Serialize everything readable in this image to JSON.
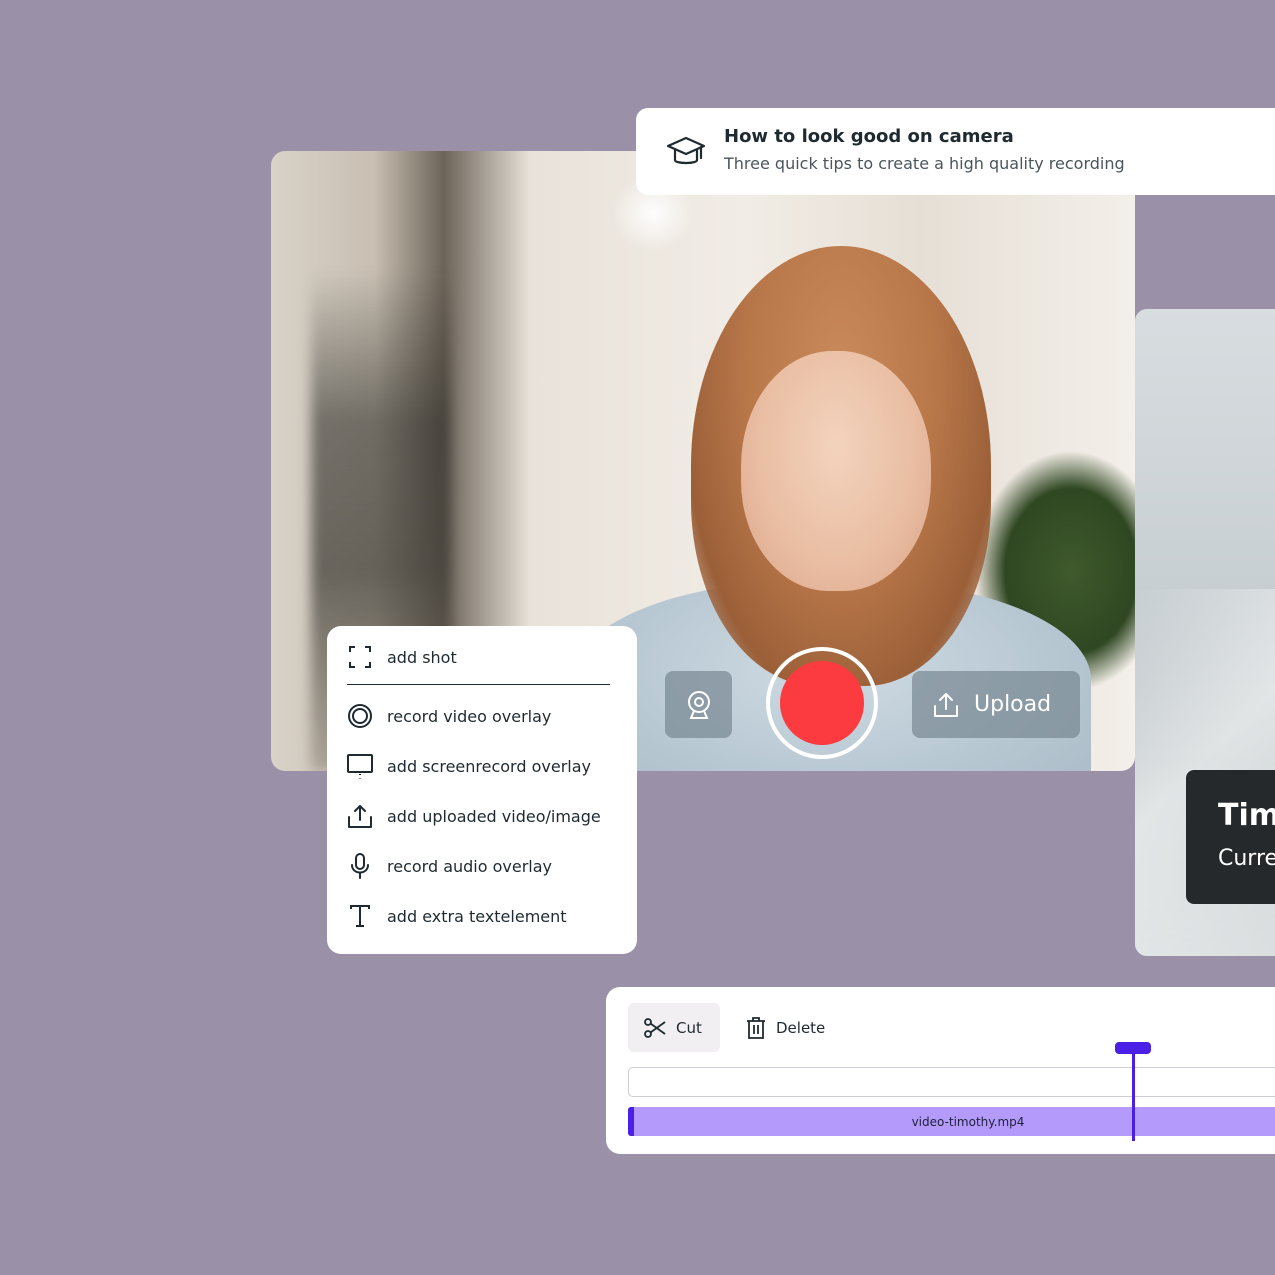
{
  "tip": {
    "icon": "graduation-cap-icon",
    "title": "How to look good on camera",
    "subtitle": "Three quick tips to create a high quality recording"
  },
  "controls": {
    "webcam_icon": "webcam-icon",
    "record_color": "#fb3b3f",
    "upload_icon": "upload-icon",
    "upload_label": "Upload"
  },
  "shot_menu": {
    "items": [
      {
        "icon": "frame-corners-icon",
        "label": "add shot"
      },
      {
        "icon": "record-circle-icon",
        "label": "record video overlay"
      },
      {
        "icon": "monitor-icon",
        "label": "add screenrecord overlay"
      },
      {
        "icon": "upload-icon",
        "label": "add uploaded video/image"
      },
      {
        "icon": "microphone-icon",
        "label": "record audio overlay"
      },
      {
        "icon": "text-icon",
        "label": "add extra textelement"
      }
    ]
  },
  "name_card": {
    "title": "Tim",
    "subtitle": "Curre"
  },
  "timeline": {
    "cut_label": "Cut",
    "delete_label": "Delete",
    "clip_name": "video-timothy.mp4",
    "accent_color": "#4a1fe6",
    "clip_color": "#b49bfb"
  },
  "colors": {
    "background": "#9a91a8"
  }
}
